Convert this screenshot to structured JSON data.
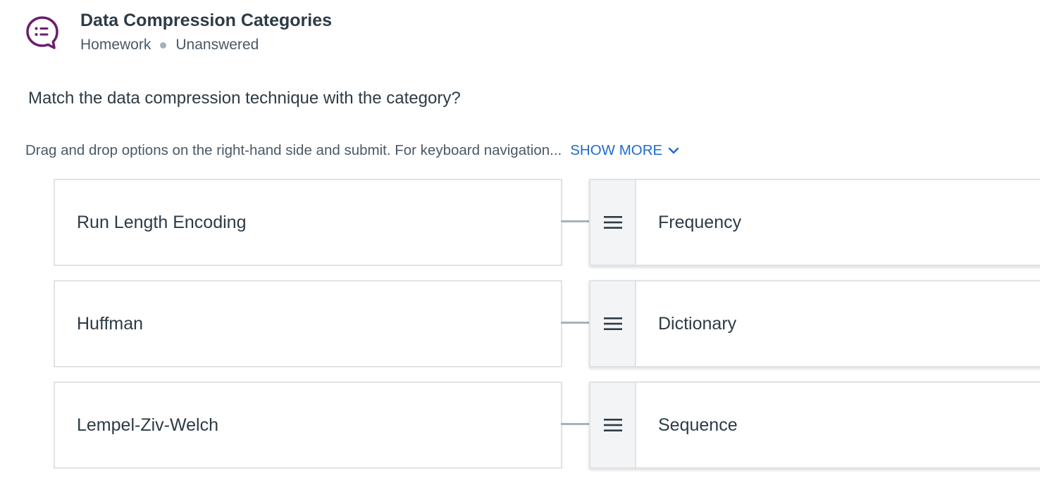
{
  "header": {
    "title": "Data Compression Categories",
    "type": "Homework",
    "status": "Unanswered",
    "icon": "discussion-list-icon",
    "icon_color": "#6b1f6e"
  },
  "question": "Match the data compression technique with the category?",
  "instructions": {
    "text": "Drag and drop options on the right-hand side and submit. For keyboard navigation...",
    "show_more_label": "SHOW MORE",
    "link_color": "#1f6bd1"
  },
  "pairs": [
    {
      "left": "Run Length Encoding",
      "right": "Frequency"
    },
    {
      "left": "Huffman",
      "right": "Dictionary"
    },
    {
      "left": "Lempel-Ziv-Welch",
      "right": "Sequence"
    }
  ]
}
